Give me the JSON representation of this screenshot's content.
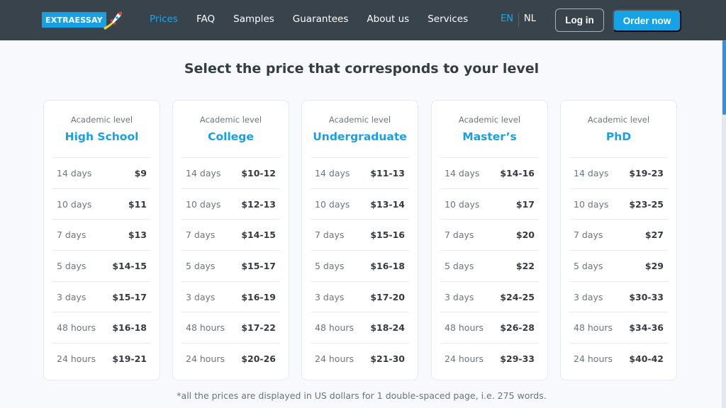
{
  "navbar": {
    "logo_text": "EXTRAESSAY",
    "links": [
      {
        "label": "Prices",
        "active": true
      },
      {
        "label": "FAQ",
        "active": false
      },
      {
        "label": "Samples",
        "active": false
      },
      {
        "label": "Guarantees",
        "active": false
      },
      {
        "label": "About us",
        "active": false
      },
      {
        "label": "Services",
        "active": false
      }
    ],
    "lang_en": "EN",
    "lang_nl": "NL",
    "login_label": "Log in",
    "order_label": "Order now"
  },
  "colors": {
    "accent": "#17a0e4",
    "navbar_bg": "#38434c",
    "page_bg": "#f7f9fc"
  },
  "heading": "Select the price that corresponds to your level",
  "cards": [
    {
      "label": "Academic level",
      "title": "High School",
      "rows": [
        {
          "term": "14 days",
          "price": "$9"
        },
        {
          "term": "10 days",
          "price": "$11"
        },
        {
          "term": "7 days",
          "price": "$13"
        },
        {
          "term": "5 days",
          "price": "$14-15"
        },
        {
          "term": "3 days",
          "price": "$15-17"
        },
        {
          "term": "48 hours",
          "price": "$16-18"
        },
        {
          "term": "24 hours",
          "price": "$19-21"
        }
      ]
    },
    {
      "label": "Academic level",
      "title": "College",
      "rows": [
        {
          "term": "14 days",
          "price": "$10-12"
        },
        {
          "term": "10 days",
          "price": "$12-13"
        },
        {
          "term": "7 days",
          "price": "$14-15"
        },
        {
          "term": "5 days",
          "price": "$15-17"
        },
        {
          "term": "3 days",
          "price": "$16-19"
        },
        {
          "term": "48 hours",
          "price": "$17-22"
        },
        {
          "term": "24 hours",
          "price": "$20-26"
        }
      ]
    },
    {
      "label": "Academic level",
      "title": "Undergraduate",
      "rows": [
        {
          "term": "14 days",
          "price": "$11-13"
        },
        {
          "term": "10 days",
          "price": "$13-14"
        },
        {
          "term": "7 days",
          "price": "$15-16"
        },
        {
          "term": "5 days",
          "price": "$16-18"
        },
        {
          "term": "3 days",
          "price": "$17-20"
        },
        {
          "term": "48 hours",
          "price": "$18-24"
        },
        {
          "term": "24 hours",
          "price": "$21-30"
        }
      ]
    },
    {
      "label": "Academic level",
      "title": "Master’s",
      "rows": [
        {
          "term": "14 days",
          "price": "$14-16"
        },
        {
          "term": "10 days",
          "price": "$17"
        },
        {
          "term": "7 days",
          "price": "$20"
        },
        {
          "term": "5 days",
          "price": "$22"
        },
        {
          "term": "3 days",
          "price": "$24-25"
        },
        {
          "term": "48 hours",
          "price": "$26-28"
        },
        {
          "term": "24 hours",
          "price": "$29-33"
        }
      ]
    },
    {
      "label": "Academic level",
      "title": "PhD",
      "rows": [
        {
          "term": "14 days",
          "price": "$19-23"
        },
        {
          "term": "10 days",
          "price": "$23-25"
        },
        {
          "term": "7 days",
          "price": "$27"
        },
        {
          "term": "5 days",
          "price": "$29"
        },
        {
          "term": "3 days",
          "price": "$30-33"
        },
        {
          "term": "48 hours",
          "price": "$34-36"
        },
        {
          "term": "24 hours",
          "price": "$40-42"
        }
      ]
    }
  ],
  "footnote": "*all the prices are displayed in US dollars for 1 double-spaced page, i.e. 275 words."
}
